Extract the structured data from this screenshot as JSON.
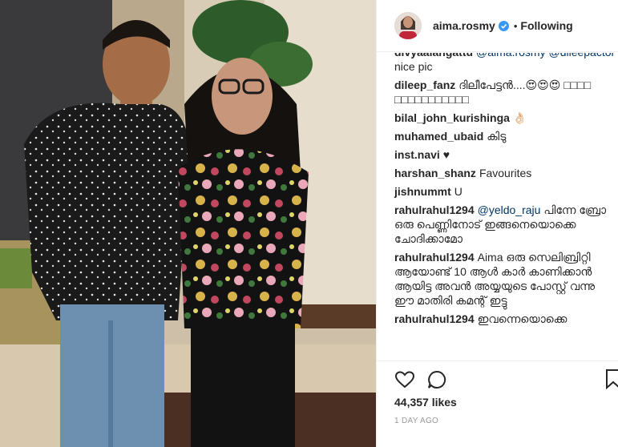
{
  "post": {
    "username": "aima.rosmy",
    "follow_separator": "•",
    "follow_state": "Following",
    "likes": "44,357 likes",
    "date": "1 DAY AGO"
  },
  "comments": [
    {
      "user": "divyaalangattu",
      "mentions": [
        "@aima.rosmy",
        "@dileepactor"
      ],
      "text": "nice pic"
    },
    {
      "user": "dileep_fanz",
      "mentions": [],
      "text": "ദിലീപേട്ടൻ....😍😍😍 □□□□ □□□□□□□□□□□"
    },
    {
      "user": "bilal_john_kurishinga",
      "mentions": [],
      "text": "👌🏻"
    },
    {
      "user": "muhamed_ubaid",
      "mentions": [],
      "text": "കിടു"
    },
    {
      "user": "inst.navi",
      "mentions": [],
      "text": "♥"
    },
    {
      "user": "harshan_shanz",
      "mentions": [],
      "text": "Favourites"
    },
    {
      "user": "jishnummt",
      "mentions": [],
      "text": "U"
    },
    {
      "user": "rahulrahul1294",
      "mentions": [
        "@yeldo_raju"
      ],
      "text": "പിന്നേ ബ്രോ ഒരു പെണ്ണിനോട് ഇങ്ങനെയൊക്കെ ചോദിക്കാമോ"
    },
    {
      "user": "rahulrahul1294",
      "mentions": [],
      "text": "Aima ഒരു സെലിബ്രിറ്റി ആയോണ്ട് 10 ആൾ കാർ കാണിക്കാൻ ആയിട്ട അവൻ അയ്യയുടെ പോസ്റ്റ് വന്നു ഈ മാതിരി കമന്റ് ഇട്ടു"
    },
    {
      "user": "rahulrahul1294",
      "mentions": [],
      "text": "ഇവന്നെയൊക്കെ"
    }
  ],
  "icons": {
    "like": "heart-icon",
    "comment": "comment-icon",
    "save": "bookmark-icon",
    "verified": "verified-badge-icon"
  },
  "colors": {
    "mention": "#003569",
    "verified": "#3897f0",
    "date": "#999999"
  }
}
